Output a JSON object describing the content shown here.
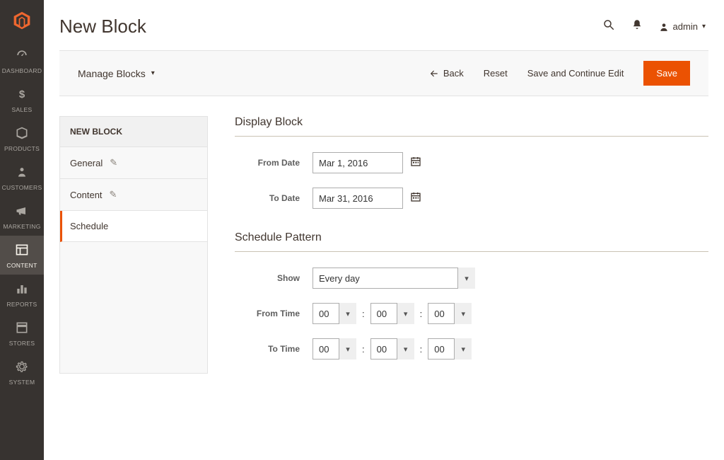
{
  "sidebar": {
    "items": [
      {
        "label": "DASHBOARD"
      },
      {
        "label": "SALES"
      },
      {
        "label": "PRODUCTS"
      },
      {
        "label": "CUSTOMERS"
      },
      {
        "label": "MARKETING"
      },
      {
        "label": "CONTENT"
      },
      {
        "label": "REPORTS"
      },
      {
        "label": "STORES"
      },
      {
        "label": "SYSTEM"
      }
    ]
  },
  "header": {
    "title": "New Block",
    "admin_label": "admin"
  },
  "toolbar": {
    "manage_blocks_label": "Manage Blocks",
    "back_label": "Back",
    "reset_label": "Reset",
    "save_continue_label": "Save and Continue Edit",
    "save_label": "Save"
  },
  "side_panel": {
    "title": "NEW BLOCK",
    "tabs": [
      {
        "label": "General"
      },
      {
        "label": "Content"
      },
      {
        "label": "Schedule"
      }
    ]
  },
  "form": {
    "display_block": {
      "title": "Display Block",
      "from_date_label": "From Date",
      "from_date_value": "Mar 1, 2016",
      "to_date_label": "To Date",
      "to_date_value": "Mar 31, 2016"
    },
    "schedule_pattern": {
      "title": "Schedule Pattern",
      "show_label": "Show",
      "show_value": "Every day",
      "from_time_label": "From Time",
      "from_time_h": "00",
      "from_time_m": "00",
      "from_time_s": "00",
      "to_time_label": "To Time",
      "to_time_h": "00",
      "to_time_m": "00",
      "to_time_s": "00"
    }
  }
}
